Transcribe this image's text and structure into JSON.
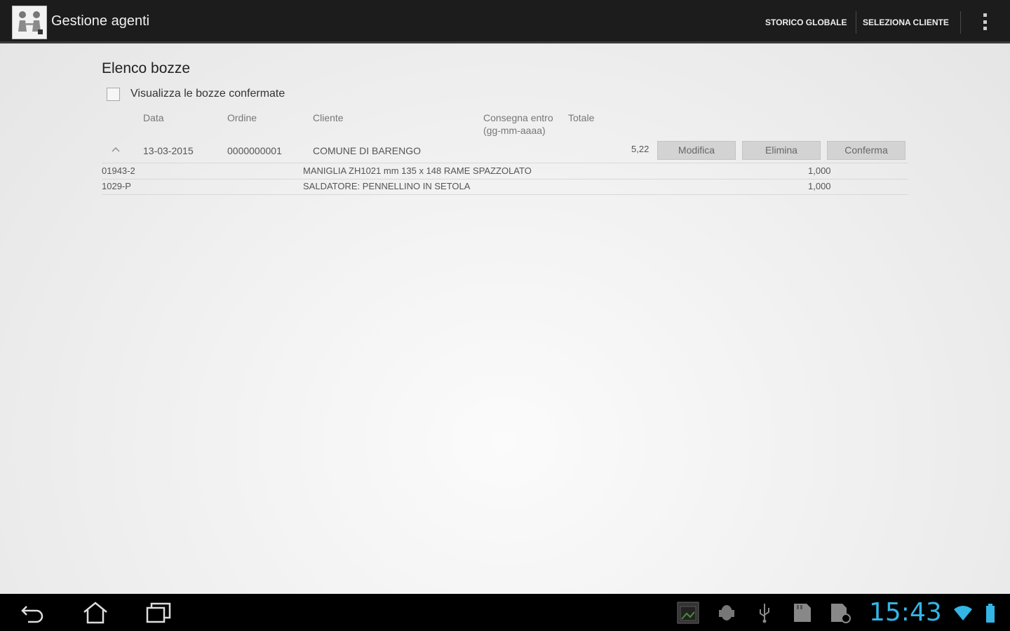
{
  "app": {
    "title": "Gestione agenti",
    "actions": [
      "STORICO GLOBALE",
      "SELEZIONA CLIENTE"
    ]
  },
  "page": {
    "title": "Elenco bozze",
    "checkbox_label": "Visualizza le bozze confermate",
    "checkbox_checked": false
  },
  "table": {
    "headers": {
      "data": "Data",
      "ordine": "Ordine",
      "cliente": "Cliente",
      "consegna_1": "Consegna entro",
      "consegna_2": "(gg-mm-aaaa)",
      "totale": "Totale"
    },
    "rows": [
      {
        "data": "13-03-2015",
        "ordine": "0000000001",
        "cliente": "COMUNE DI BARENGO",
        "consegna": "",
        "totale": "5,22",
        "buttons": {
          "modifica": "Modifica",
          "elimina": "Elimina",
          "conferma": "Conferma"
        },
        "details": [
          {
            "code": "01943-2",
            "description": "MANIGLIA ZH1021 mm 135 x 148 RAME SPAZZOLATO",
            "qty": "1,000"
          },
          {
            "code": "1029-P",
            "description": "SALDATORE: PENNELLINO IN SETOLA",
            "qty": "1,000"
          }
        ]
      }
    ]
  },
  "system_bar": {
    "clock": "15:43",
    "accent_color": "#33b5e5"
  },
  "icons": [
    "app-logo-icon",
    "overflow-menu-icon",
    "collapse-icon",
    "back-icon",
    "home-icon",
    "recent-apps-icon",
    "gallery-notification-icon",
    "android-debug-icon",
    "usb-icon",
    "sd-card-icon",
    "sd-card-scan-icon",
    "wifi-icon",
    "battery-icon"
  ]
}
